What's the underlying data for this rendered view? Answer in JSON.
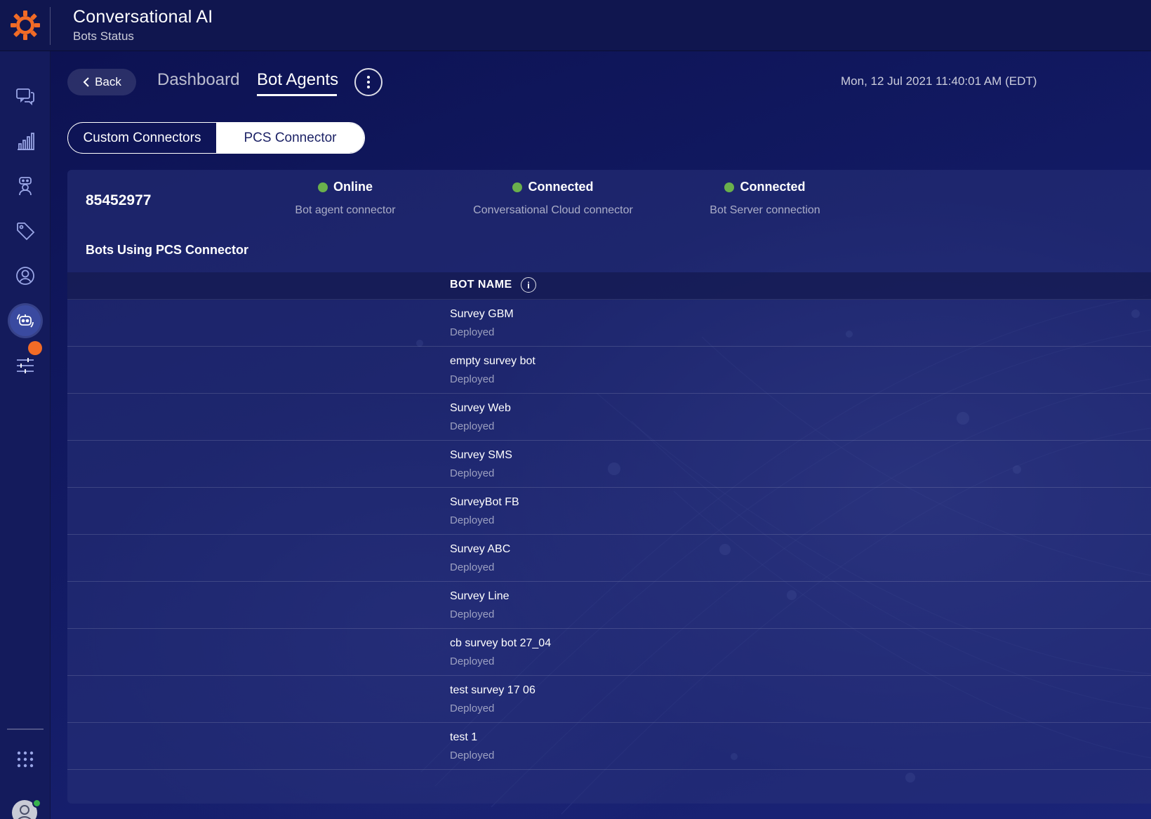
{
  "header": {
    "app_title": "Conversational AI",
    "app_subtitle": "Bots Status"
  },
  "sidebar": {
    "items": [
      {
        "icon": "chat-icon"
      },
      {
        "icon": "analytics-icon"
      },
      {
        "icon": "agent-icon"
      },
      {
        "icon": "tag-icon"
      },
      {
        "icon": "user-icon"
      },
      {
        "icon": "bot-icon",
        "active": true
      },
      {
        "icon": "settings-sliders-icon",
        "notification": true
      }
    ],
    "bottom": [
      {
        "icon": "apps-grid-icon"
      },
      {
        "icon": "avatar"
      }
    ]
  },
  "nav": {
    "back_label": "Back",
    "tabs": [
      {
        "label": "Dashboard",
        "active": false
      },
      {
        "label": "Bot Agents",
        "active": true
      }
    ],
    "timestamp": "Mon, 12 Jul 2021 11:40:01 AM (EDT)"
  },
  "connector_toggle": {
    "options": [
      "Custom Connectors",
      "PCS Connector"
    ],
    "selected": "PCS Connector"
  },
  "agent": {
    "id": "85452977",
    "statuses": [
      {
        "state": "Online",
        "label": "Bot agent connector",
        "color": "#6ab04c"
      },
      {
        "state": "Connected",
        "label": "Conversational Cloud connector",
        "color": "#6ab04c"
      },
      {
        "state": "Connected",
        "label": "Bot Server connection",
        "color": "#6ab04c"
      }
    ]
  },
  "bots_section": {
    "title": "Bots Using PCS Connector",
    "column_header": "BOT NAME",
    "rows": [
      {
        "name": "Survey GBM",
        "status": "Deployed"
      },
      {
        "name": "empty survey bot",
        "status": "Deployed"
      },
      {
        "name": "Survey Web",
        "status": "Deployed"
      },
      {
        "name": "Survey SMS",
        "status": "Deployed"
      },
      {
        "name": "SurveyBot FB",
        "status": "Deployed"
      },
      {
        "name": "Survey ABC",
        "status": "Deployed"
      },
      {
        "name": "Survey Line",
        "status": "Deployed"
      },
      {
        "name": "cb survey bot 27_04",
        "status": "Deployed"
      },
      {
        "name": "test survey 17 06",
        "status": "Deployed"
      },
      {
        "name": "test 1",
        "status": "Deployed"
      }
    ]
  },
  "colors": {
    "brand_accent": "#f26b26",
    "status_green": "#6ab04c",
    "background": "#121a63"
  }
}
